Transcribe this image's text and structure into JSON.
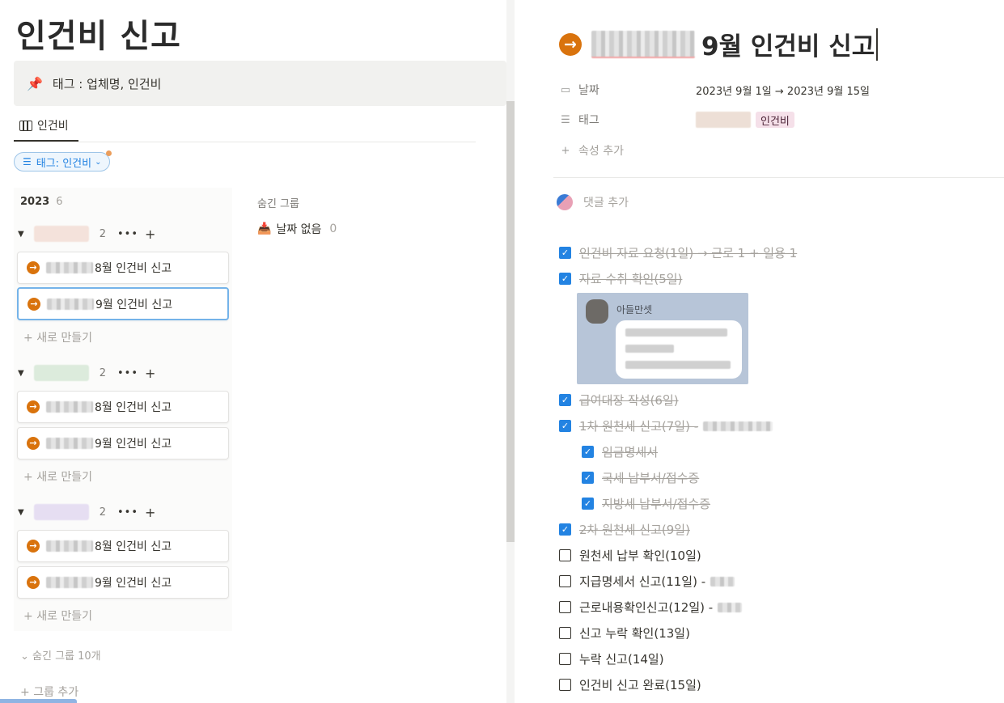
{
  "left": {
    "page_title": "인건비 신고",
    "callout": {
      "icon": "pushpin-icon",
      "text": "태그 : 업체명, 인건비"
    },
    "view_tab": "인건비",
    "filter": "태그: 인건비",
    "year": {
      "label": "2023",
      "count": "6"
    },
    "groups": [
      {
        "color": "#f4e2db",
        "count": "2",
        "cards": [
          "8월 인건비 신고",
          "9월 인건비 신고"
        ],
        "new_label": "새로 만들기"
      },
      {
        "color": "#dcebdc",
        "count": "2",
        "cards": [
          "8월 인건비 신고",
          "9월 인건비 신고"
        ],
        "new_label": "새로 만들기"
      },
      {
        "color": "#e6def2",
        "count": "2",
        "cards": [
          "8월 인건비 신고",
          "9월 인건비 신고"
        ],
        "new_label": "새로 만들기"
      }
    ],
    "hidden_groups_col": {
      "label": "숨긴 그룹",
      "no_date": "날짜 없음",
      "no_date_count": "0"
    },
    "hidden_groups_toggle": "숨긴 그룹 10개",
    "add_group": "그룹 추가"
  },
  "right": {
    "title": "9월 인건비 신고",
    "props": {
      "date_label": "날짜",
      "date_value": "2023년 9월 1일 → 2023년 9월 15일",
      "tag_label": "태그",
      "tag_value": "인건비",
      "add_prop": "속성 추가"
    },
    "comment_placeholder": "댓글 추가",
    "chat_image_name": "아들만셋",
    "todos": [
      {
        "text": "인건비 자료 요청(1일) → 근로 1 + 일용 1",
        "checked": true
      },
      {
        "text": "자료 수취 확인(5일)",
        "checked": true
      },
      {
        "text": "급여대장 작성(6일)",
        "checked": true
      },
      {
        "text": "1차 원천세 신고(7일) -",
        "checked": true
      },
      {
        "text": "임금명세서",
        "checked": true
      },
      {
        "text": "국세 납부서/접수증",
        "checked": true
      },
      {
        "text": "지방세 납부서/접수증",
        "checked": true
      },
      {
        "text": "2차 원천세 신고(9일)",
        "checked": true
      },
      {
        "text": "원천세 납부 확인(10일)",
        "checked": false
      },
      {
        "text": "지급명세서 신고(11일) -",
        "checked": false
      },
      {
        "text": "근로내용확인신고(12일) -",
        "checked": false
      },
      {
        "text": "신고 누락 확인(13일)",
        "checked": false
      },
      {
        "text": "누락 신고(14일)",
        "checked": false
      },
      {
        "text": "인건비 신고 완료(15일)",
        "checked": false
      }
    ]
  },
  "colors": {
    "accent": "#2383e2",
    "arrow": "#d9730d"
  }
}
